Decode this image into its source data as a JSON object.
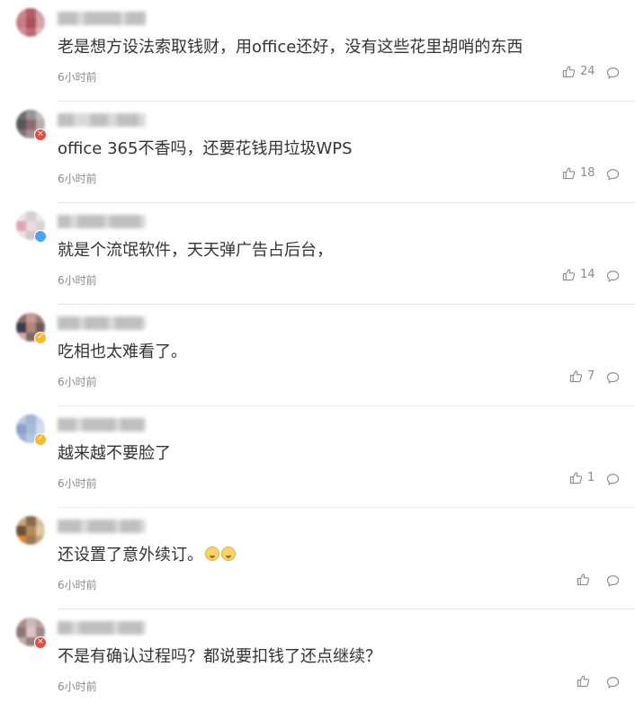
{
  "comments": [
    {
      "text": "老是想方设法索取钱财，用office还好，没有这些花里胡哨的东西",
      "time": "6小时前",
      "likes": "24",
      "avatar": [
        "#c9868c",
        "#b85a66",
        "#d6a3a8",
        "#c87c85",
        "#a7515e",
        "#d8a2aa",
        "#cf9098",
        "#b86c76",
        "#e2b9bd"
      ],
      "badge": null
    },
    {
      "text": "office 365不香吗，还要花钱用垃圾WPS",
      "time": "6小时前",
      "likes": "18",
      "avatar": [
        "#6e6a6e",
        "#9a9497",
        "#c2bcbd",
        "#5a5558",
        "#8f6a6d",
        "#b8aeb0",
        "#7d7477",
        "#a58f92",
        "#d1c8c9"
      ],
      "badge": "red"
    },
    {
      "text": "就是个流氓软件，天天弹广告占后台，",
      "time": "6小时前",
      "likes": "14",
      "avatar": [
        "#e9e4e6",
        "#d7cfd3",
        "#efe9ea",
        "#e0a6ad",
        "#f0d8dc",
        "#d9d3d6",
        "#e8e2e4",
        "#cfc7cb",
        "#f2eeef"
      ],
      "badge": "blue"
    },
    {
      "text": "吃相也太难看了。",
      "time": "6小时前",
      "likes": "7",
      "avatar": [
        "#8a6d6a",
        "#c79a8e",
        "#9a7a73",
        "#3c3a52",
        "#b48679",
        "#6e5a5c",
        "#d2b0a4",
        "#7f6a6b",
        "#aa8c86"
      ],
      "badge": "gold"
    },
    {
      "text": "越来越不要脸了",
      "time": "6小时前",
      "likes": "1",
      "avatar": [
        "#b9c9e0",
        "#9fb6d6",
        "#c8d6ea",
        "#8aa2c6",
        "#a9bcd9",
        "#d2ddee",
        "#9db2d2",
        "#b6c6df",
        "#c4d2e7"
      ],
      "badge": "gold"
    },
    {
      "text": "还设置了意外续订。",
      "time": "6小时前",
      "likes": "",
      "avatar": [
        "#c8a77a",
        "#8a6a4c",
        "#d9bb8f",
        "#6d5238",
        "#b48a5e",
        "#e0c9a4",
        "#e3823a",
        "#9c7a55",
        "#c9a57c"
      ],
      "badge": null,
      "emoji": true
    },
    {
      "text": "不是有确认过程吗？都说要扣钱了还点继续？",
      "time": "6小时前",
      "likes": "",
      "avatar": [
        "#a98e8c",
        "#cdbab8",
        "#b7a09e",
        "#8f7674",
        "#d8c7c5",
        "#a28886",
        "#c1aba9",
        "#9a807e",
        "#e1d2d0"
      ],
      "badge": "red"
    }
  ],
  "colors": {
    "badge_red": "#e54d42",
    "badge_blue": "#4aa3f0",
    "badge_gold": "#f5b82e",
    "meta": "#8c8c8c"
  },
  "icons": {
    "like": "thumbs-up-icon",
    "reply": "comment-bubble-icon"
  }
}
